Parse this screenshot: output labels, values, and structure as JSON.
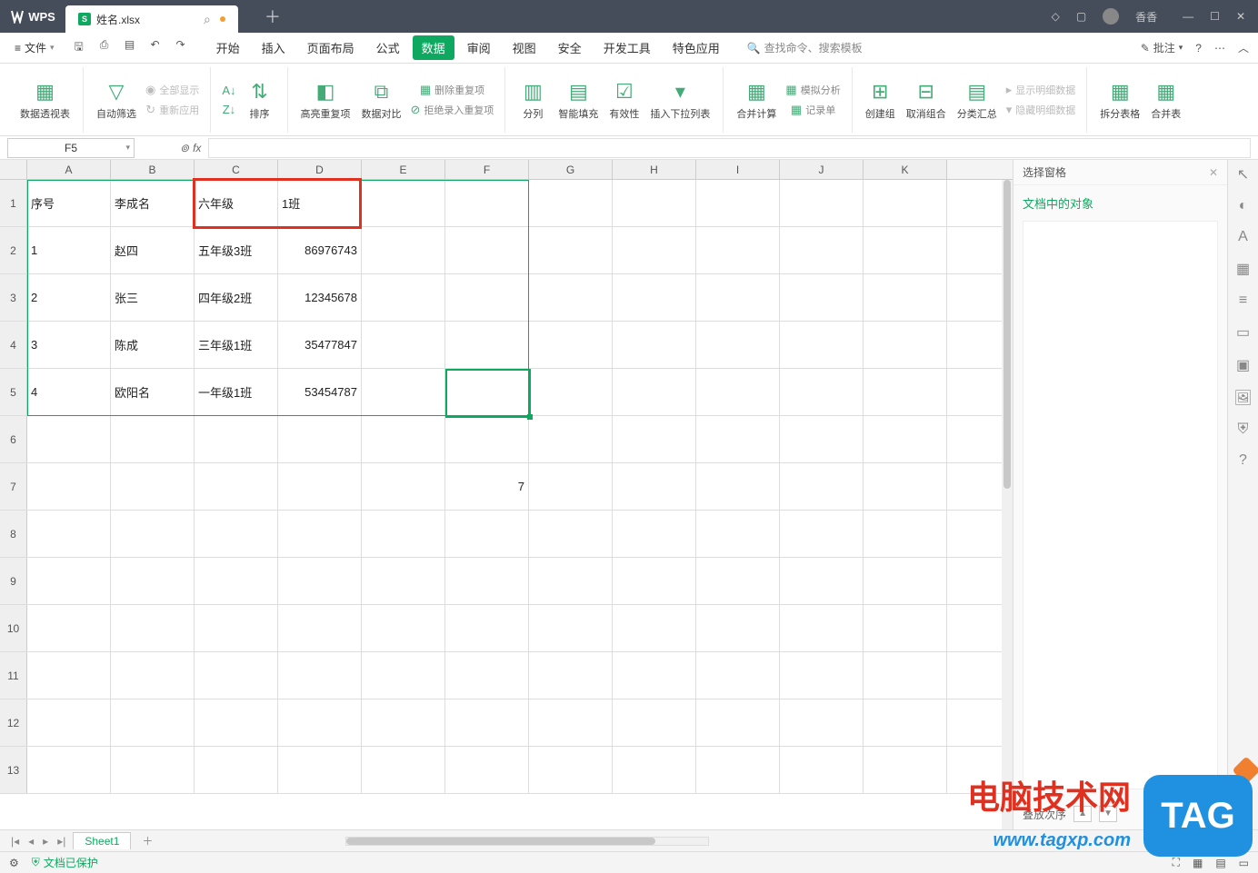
{
  "app": {
    "name": "WPS",
    "doc_tab": "姓名.xlsx",
    "user": "香香"
  },
  "file_menu": "文件",
  "menu_tabs": [
    "开始",
    "插入",
    "页面布局",
    "公式",
    "数据",
    "审阅",
    "视图",
    "安全",
    "开发工具",
    "特色应用"
  ],
  "active_menu_tab": "数据",
  "search_placeholder": "查找命令、搜索模板",
  "annotate_label": "批注",
  "ribbon": {
    "pivot": "数据透视表",
    "autofilter": "自动筛选",
    "show_all": "全部显示",
    "reapply": "重新应用",
    "sort": "排序",
    "highlight_dup": "高亮重复项",
    "data_compare": "数据对比",
    "remove_dup": "删除重复项",
    "reject_dup": "拒绝录入重复项",
    "text_to_cols": "分列",
    "smart_fill": "智能填充",
    "validation": "有效性",
    "dropdown": "插入下拉列表",
    "consolidate": "合并计算",
    "record_form": "记录单",
    "what_if": "模拟分析",
    "group": "创建组",
    "ungroup": "取消组合",
    "subtotal": "分类汇总",
    "show_detail": "显示明细数据",
    "hide_detail": "隐藏明细数据",
    "split_table": "拆分表格",
    "merge_table": "合并表"
  },
  "name_box": "F5",
  "fx": "fx",
  "columns": [
    "A",
    "B",
    "C",
    "D",
    "E",
    "F",
    "G",
    "H",
    "I",
    "J",
    "K"
  ],
  "rows": [
    {
      "n": "1",
      "A": "序号",
      "B": "李成名",
      "C": "六年级",
      "D": "1班",
      "E": "",
      "F": ""
    },
    {
      "n": "2",
      "A": "1",
      "B": "赵四",
      "C": "五年级3班",
      "D": "86976743",
      "E": "",
      "F": ""
    },
    {
      "n": "3",
      "A": "2",
      "B": "张三",
      "C": "四年级2班",
      "D": "12345678",
      "E": "",
      "F": ""
    },
    {
      "n": "4",
      "A": "3",
      "B": "陈成",
      "C": "三年级1班",
      "D": "35477847",
      "E": "",
      "F": ""
    },
    {
      "n": "5",
      "A": "4",
      "B": "欧阳名",
      "C": "一年级1班",
      "D": "53454787",
      "E": "",
      "F": ""
    },
    {
      "n": "6",
      "A": "",
      "B": "",
      "C": "",
      "D": "",
      "E": "",
      "F": ""
    },
    {
      "n": "7",
      "A": "",
      "B": "",
      "C": "",
      "D": "",
      "E": "",
      "F": "7"
    },
    {
      "n": "8",
      "A": "",
      "B": "",
      "C": "",
      "D": "",
      "E": "",
      "F": ""
    },
    {
      "n": "9",
      "A": "",
      "B": "",
      "C": "",
      "D": "",
      "E": "",
      "F": ""
    },
    {
      "n": "10",
      "A": "",
      "B": "",
      "C": "",
      "D": "",
      "E": "",
      "F": ""
    },
    {
      "n": "11",
      "A": "",
      "B": "",
      "C": "",
      "D": "",
      "E": "",
      "F": ""
    },
    {
      "n": "12",
      "A": "",
      "B": "",
      "C": "",
      "D": "",
      "E": "",
      "F": ""
    },
    {
      "n": "13",
      "A": "",
      "B": "",
      "C": "",
      "D": "",
      "E": "",
      "F": ""
    }
  ],
  "sheet_tab": "Sheet1",
  "side_panel": {
    "header": "选择窗格",
    "title": "文档中的对象",
    "footer": "叠放次序"
  },
  "status": {
    "protect": "文档已保护"
  },
  "watermark": {
    "line1": "电脑技术网",
    "line2": "www.tagxp.com",
    "badge": "TAG"
  }
}
